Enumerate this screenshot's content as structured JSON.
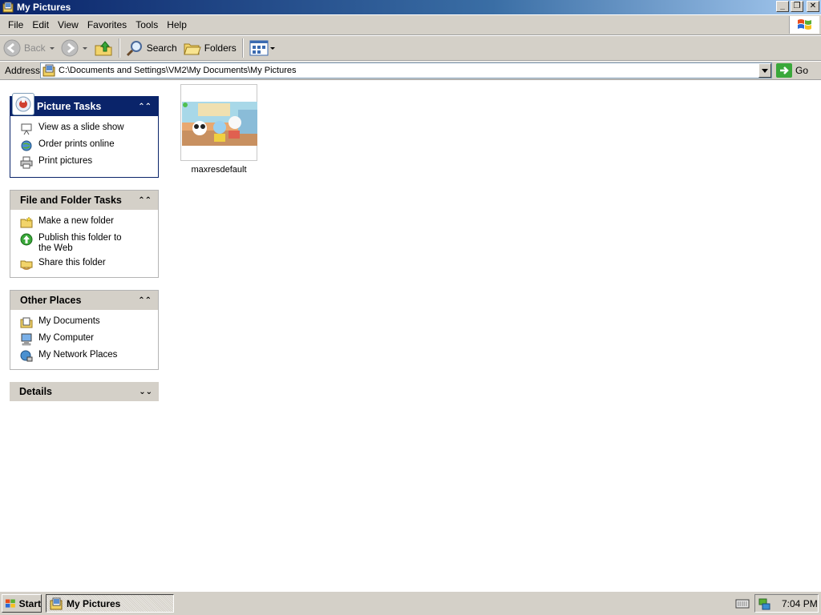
{
  "window": {
    "title": "My Pictures",
    "controls": [
      "minimize",
      "restore",
      "close"
    ]
  },
  "menubar": {
    "items": [
      "File",
      "Edit",
      "View",
      "Favorites",
      "Tools",
      "Help"
    ]
  },
  "toolbar": {
    "back_label": "Back",
    "search_label": "Search",
    "folders_label": "Folders"
  },
  "address": {
    "label": "Address",
    "value": "C:\\Documents and Settings\\VM2\\My Documents\\My Pictures",
    "go_label": "Go"
  },
  "taskpane": {
    "picture_tasks": {
      "title": "Picture Tasks",
      "items": [
        "View as a slide show",
        "Order prints online",
        "Print pictures"
      ]
    },
    "file_folder_tasks": {
      "title": "File and Folder Tasks",
      "items": [
        "Make a new folder",
        "Publish this folder to the Web",
        "Share this folder"
      ]
    },
    "other_places": {
      "title": "Other Places",
      "items": [
        "My Documents",
        "My Computer",
        "My Network Places"
      ]
    },
    "details": {
      "title": "Details"
    }
  },
  "content": {
    "files": [
      {
        "name": "maxresdefault"
      }
    ]
  },
  "taskbar": {
    "start_label": "Start",
    "active_window": "My Pictures",
    "clock": "7:04 PM"
  },
  "colors": {
    "titlebar": "#0a246a",
    "chrome": "#d4d0c8",
    "panel_header_special": "#0a246a"
  }
}
